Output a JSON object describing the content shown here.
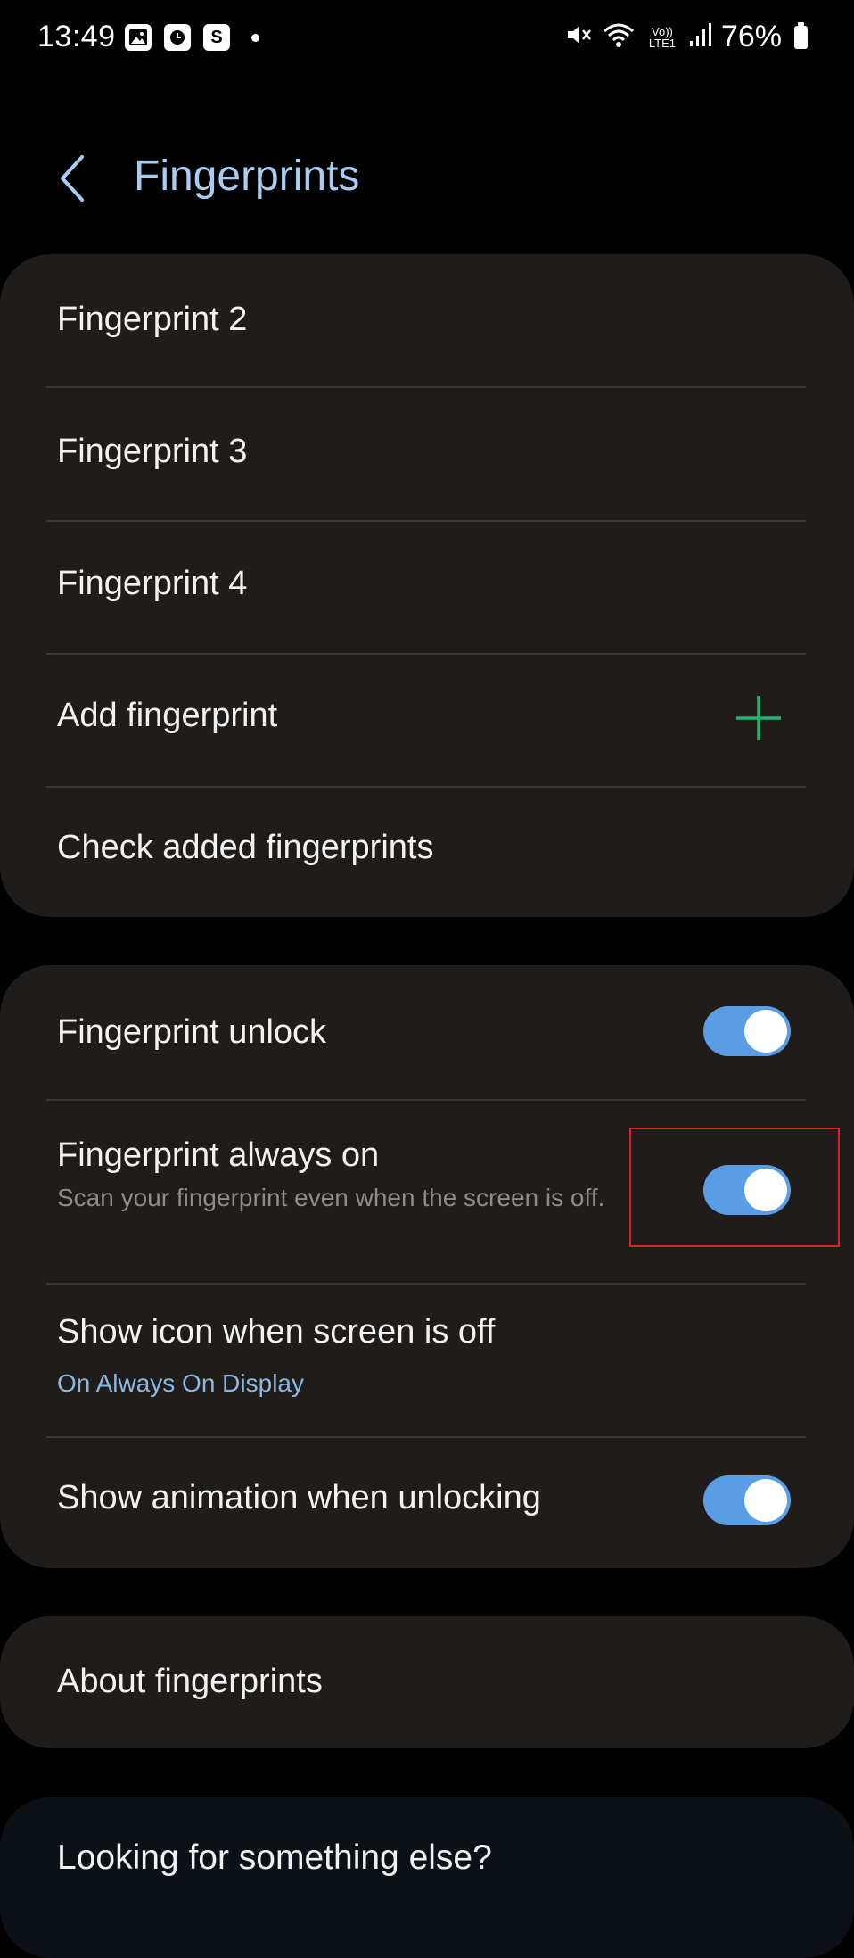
{
  "status_bar": {
    "time": "13:49",
    "left_icons": [
      "gallery-icon",
      "clock-icon",
      "s-app-icon",
      "dot"
    ],
    "s_app_glyph": "S",
    "network": "Vo)) LTE1",
    "battery": "76%"
  },
  "header": {
    "title": "Fingerprints",
    "title_color": "#a9cdf0"
  },
  "fingerprints_list": {
    "items": [
      {
        "label": "Fingerprint 2"
      },
      {
        "label": "Fingerprint 3"
      },
      {
        "label": "Fingerprint 4"
      }
    ],
    "add_label": "Add fingerprint",
    "check_label": "Check added fingerprints"
  },
  "settings": {
    "fingerprint_unlock": {
      "label": "Fingerprint unlock",
      "enabled": true
    },
    "always_on": {
      "label": "Fingerprint always on",
      "description": "Scan your fingerprint even when the screen is off.",
      "enabled": true
    },
    "show_icon": {
      "label": "Show icon when screen is off",
      "value": "On Always On Display"
    },
    "show_animation": {
      "label": "Show animation when unlocking",
      "enabled": true
    }
  },
  "about": {
    "label": "About fingerprints"
  },
  "looking": {
    "label": "Looking for something else?"
  },
  "colors": {
    "accent_toggle": "#5b9de5",
    "plus_green": "#1db86e",
    "card_bg": "#1f1c19",
    "highlight": "#d9232b"
  }
}
